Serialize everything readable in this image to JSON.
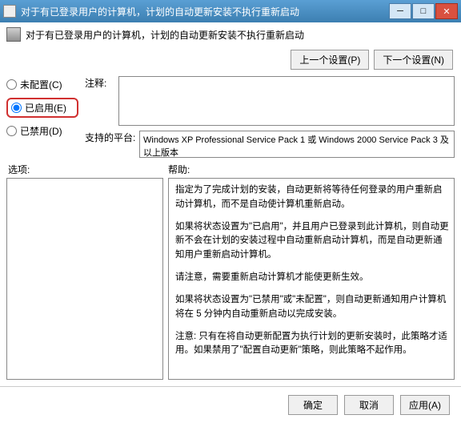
{
  "window": {
    "title": "对于有已登录用户的计算机，计划的自动更新安装不执行重新启动"
  },
  "subtitle": "对于有已登录用户的计算机，计划的自动更新安装不执行重新启动",
  "nav": {
    "prev": "上一个设置(P)",
    "next": "下一个设置(N)"
  },
  "radios": {
    "not_configured": "未配置(C)",
    "enabled": "已启用(E)",
    "disabled": "已禁用(D)"
  },
  "fields": {
    "notes_label": "注释:",
    "notes_value": "",
    "platform_label": "支持的平台:",
    "platform_value": "Windows XP Professional Service Pack 1 或 Windows 2000 Service Pack 3 及以上版本"
  },
  "sections": {
    "options_label": "选项:",
    "help_label": "帮助:"
  },
  "help": {
    "p1": "指定为了完成计划的安装，自动更新将等待任何登录的用户重新启动计算机，而不是自动使计算机重新启动。",
    "p2": "如果将状态设置为\"已启用\"，并且用户已登录到此计算机，则自动更新不会在计划的安装过程中自动重新启动计算机，而是自动更新通知用户重新启动计算机。",
    "p3": "请注意，需要重新启动计算机才能使更新生效。",
    "p4": "如果将状态设置为\"已禁用\"或\"未配置\"，则自动更新通知用户计算机将在 5 分钟内自动重新启动以完成安装。",
    "p5": "注意: 只有在将自动更新配置为执行计划的更新安装时，此策略才适用。如果禁用了\"配置自动更新\"策略，则此策略不起作用。"
  },
  "footer": {
    "ok": "确定",
    "cancel": "取消",
    "apply": "应用(A)"
  }
}
